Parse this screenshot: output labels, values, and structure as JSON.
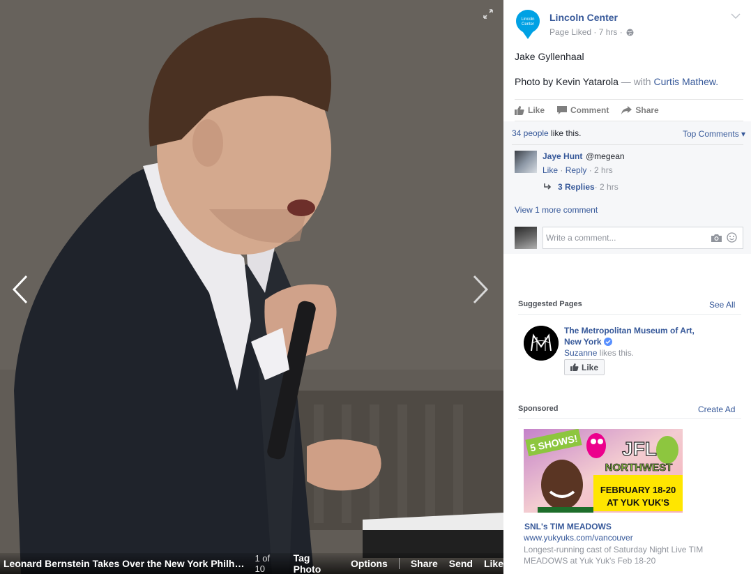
{
  "stage": {
    "album_title": "Leonard Bernstein Takes Over the New York Philharmo...",
    "photo_count": "1 of 10",
    "actions": [
      "Tag Photo",
      "Options",
      "Share",
      "Send",
      "Like"
    ]
  },
  "post": {
    "page_name": "Lincoln Center",
    "logo_text_1": "Lincoln",
    "logo_text_2": "Center",
    "meta": "Page Liked · 7 hrs ·",
    "text_1": "Jake Gyllenhaal",
    "text_2_prefix": "Photo by Kevin Yatarola",
    "text_2_with": " — with ",
    "text_2_tag": "Curtis Mathew.",
    "actions": {
      "like": "Like",
      "comment": "Comment",
      "share": "Share"
    }
  },
  "comments": {
    "likes_count": "34 people",
    "likes_suffix": " like this.",
    "top_comments": "Top Comments ▾",
    "author": "Jaye Hunt",
    "text": "@megean",
    "like": "Like",
    "reply": "Reply",
    "time": " · 2 hrs",
    "replies": "3 Replies",
    "replies_time": " · 2 hrs",
    "view_more": "View 1 more comment",
    "placeholder": "Write a comment..."
  },
  "suggested": {
    "heading": "Suggested Pages",
    "see_all": "See All",
    "page_name": "The Metropolitan Museum of Art, New York",
    "friend": "Suzanne",
    "social_suffix": " likes this.",
    "like_button": "Like"
  },
  "sponsored": {
    "heading": "Sponsored",
    "create_ad": "Create Ad",
    "banner_badge": "5 SHOWS!",
    "banner_brand": "JFL",
    "banner_region": "NORTHWEST",
    "banner_dates": "FEBRUARY 18-20",
    "banner_venue": "AT YUK YUK'S",
    "title": "SNL's TIM MEADOWS",
    "url": "www.yukyuks.com/vancouver",
    "description": "Longest-running cast of Saturday Night Live TIM MEADOWS at Yuk Yuk's Feb 18-20"
  },
  "colors": {
    "link": "#365899",
    "muted": "#90949c",
    "lincoln_teal": "#00a1e4",
    "ad_green": "#8dc63f",
    "ad_pink": "#ec008c",
    "ad_yellow": "#ffe600"
  }
}
